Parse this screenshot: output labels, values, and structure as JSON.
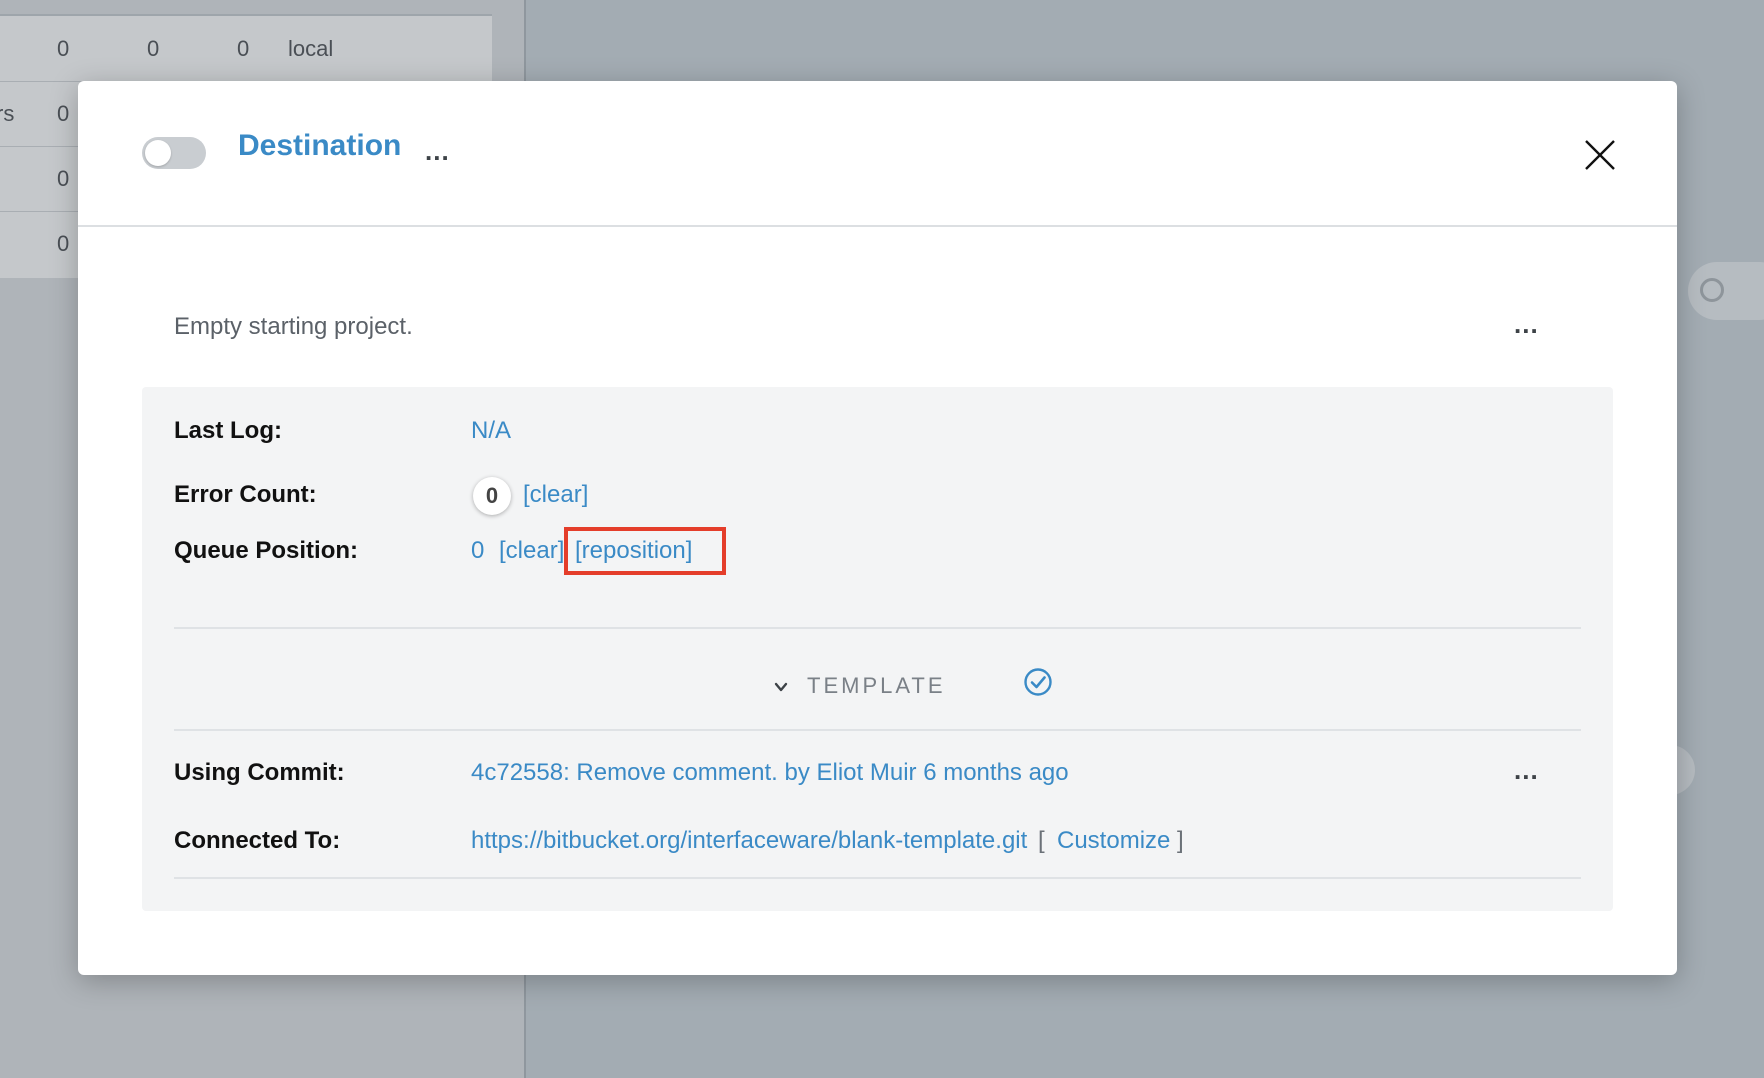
{
  "background": {
    "table_rows": [
      {
        "cells": [
          "0",
          "0",
          "0",
          "local"
        ],
        "prefix": ""
      },
      {
        "cells": [
          "0"
        ],
        "prefix": "rs"
      },
      {
        "cells": [
          "0"
        ],
        "prefix": ""
      },
      {
        "cells": [
          "0"
        ],
        "prefix": ""
      }
    ]
  },
  "modal": {
    "title": "Destination",
    "toggle_on": false,
    "menu_glyph": "...",
    "description": "Empty starting project.",
    "fields": {
      "last_log_label": "Last Log:",
      "last_log_value": "N/A",
      "error_count_label": "Error Count:",
      "error_count_value": "0",
      "error_clear_link": "[clear]",
      "queue_position_label": "Queue Position:",
      "queue_position_value": "0",
      "queue_clear_link": "[clear]",
      "queue_reposition_link": "[reposition]"
    },
    "template": {
      "label": "TEMPLATE",
      "using_commit_label": "Using Commit:",
      "using_commit_value": "4c72558: Remove comment. by Eliot Muir 6 months ago",
      "connected_to_label": "Connected To:",
      "connected_to_value": "https://bitbucket.org/interfaceware/blank-template.git",
      "customize_open": "[",
      "customize_link": "Customize",
      "customize_close": "]"
    },
    "colors": {
      "link": "#3a8ac6",
      "highlight": "#e43d2a"
    }
  }
}
